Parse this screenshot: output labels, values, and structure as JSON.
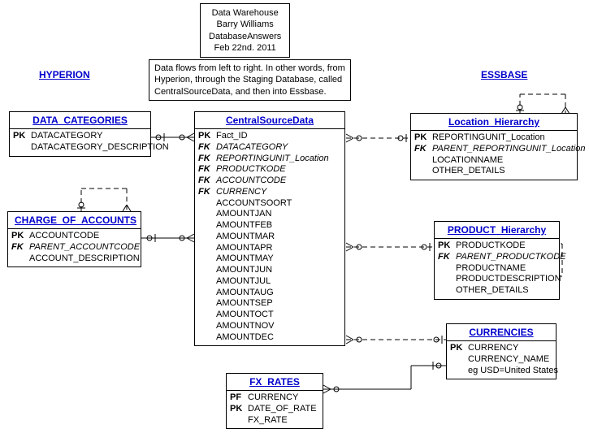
{
  "info": {
    "line1": "Data Warehouse",
    "line2": "Barry Williams",
    "line3": "DatabaseAnswers",
    "line4": "Feb 22nd. 2011"
  },
  "flow": {
    "line1": "Data flows from left to right. In other words, from",
    "line2": "Hyperion, through the Staging Database, called",
    "line3": "CentralSourceData, and then into Essbase."
  },
  "systems": {
    "left": "HYPERION",
    "right": "ESSBASE"
  },
  "entities": {
    "data_categories": {
      "title": "DATA_CATEGORIES",
      "rows": [
        {
          "k": "PK",
          "n": "DATACATEGORY"
        },
        {
          "k": "",
          "n": "DATACATEGORY_DESCRIPTION"
        }
      ]
    },
    "charge_of_accounts": {
      "title": "CHARGE_OF_ACCOUNTS",
      "rows": [
        {
          "k": "PK",
          "n": "ACCOUNTCODE"
        },
        {
          "k": "FK",
          "n": "PARENT_ACCOUNTCODE",
          "fk": true
        },
        {
          "k": "",
          "n": "ACCOUNT_DESCRIPTION"
        }
      ]
    },
    "central_source_data": {
      "title": "CentralSourceData",
      "rows": [
        {
          "k": "PK",
          "n": "Fact_ID"
        },
        {
          "k": "FK",
          "n": "DATACATEGORY",
          "fk": true
        },
        {
          "k": "FK",
          "n": "REPORTINGUNIT_Location",
          "fk": true
        },
        {
          "k": "FK",
          "n": "PRODUCTKODE",
          "fk": true
        },
        {
          "k": "FK",
          "n": "ACCOUNTCODE",
          "fk": true
        },
        {
          "k": "FK",
          "n": "CURRENCY",
          "fk": true
        },
        {
          "k": "",
          "n": "ACCOUNTSOORT"
        },
        {
          "k": "",
          "n": "AMOUNTJAN"
        },
        {
          "k": "",
          "n": "AMOUNTFEB"
        },
        {
          "k": "",
          "n": "AMOUNTMAR"
        },
        {
          "k": "",
          "n": "AMOUNTAPR"
        },
        {
          "k": "",
          "n": "AMOUNTMAY"
        },
        {
          "k": "",
          "n": "AMOUNTJUN"
        },
        {
          "k": "",
          "n": "AMOUNTJUL"
        },
        {
          "k": "",
          "n": "AMOUNTAUG"
        },
        {
          "k": "",
          "n": "AMOUNTSEP"
        },
        {
          "k": "",
          "n": "AMOUNTOCT"
        },
        {
          "k": "",
          "n": "AMOUNTNOV"
        },
        {
          "k": "",
          "n": "AMOUNTDEC"
        }
      ]
    },
    "location_hierarchy": {
      "title": "Location_Hierarchy",
      "rows": [
        {
          "k": "PK",
          "n": "REPORTINGUNIT_Location"
        },
        {
          "k": "FK",
          "n": "PARENT_REPORTINGUNIT_Location",
          "fk": true
        },
        {
          "k": "",
          "n": "LOCATIONNAME"
        },
        {
          "k": "",
          "n": "OTHER_DETAILS"
        }
      ]
    },
    "product_hierarchy": {
      "title": "PRODUCT_Hierarchy",
      "rows": [
        {
          "k": "PK",
          "n": "PRODUCTKODE"
        },
        {
          "k": "FK",
          "n": "PARENT_PRODUCTKODE",
          "fk": true
        },
        {
          "k": "",
          "n": "PRODUCTNAME"
        },
        {
          "k": "",
          "n": "PRODUCTDESCRIPTION"
        },
        {
          "k": "",
          "n": "OTHER_DETAILS"
        }
      ]
    },
    "currencies": {
      "title": "CURRENCIES",
      "rows": [
        {
          "k": "PK",
          "n": "CURRENCY"
        },
        {
          "k": "",
          "n": "CURRENCY_NAME"
        },
        {
          "k": "",
          "n": "eg USD=United States"
        }
      ]
    },
    "fx_rates": {
      "title": "FX_RATES",
      "rows": [
        {
          "k": "PF",
          "n": "CURRENCY"
        },
        {
          "k": "PK",
          "n": "DATE_OF_RATE"
        },
        {
          "k": "",
          "n": "FX_RATE"
        }
      ]
    }
  },
  "chart_data": {
    "type": "table",
    "diagram": "ER",
    "title": "Data Warehouse",
    "entities": [
      "DATA_CATEGORIES",
      "CHARGE_OF_ACCOUNTS",
      "CentralSourceData",
      "Location_Hierarchy",
      "PRODUCT_Hierarchy",
      "CURRENCIES",
      "FX_RATES"
    ],
    "relationships": [
      {
        "from": "DATA_CATEGORIES",
        "to": "CentralSourceData",
        "type": "one-to-many"
      },
      {
        "from": "CHARGE_OF_ACCOUNTS",
        "to": "CentralSourceData",
        "type": "one-to-many"
      },
      {
        "from": "CHARGE_OF_ACCOUNTS",
        "to": "CHARGE_OF_ACCOUNTS",
        "type": "self-one-to-many"
      },
      {
        "from": "CentralSourceData",
        "to": "Location_Hierarchy",
        "type": "many-to-one"
      },
      {
        "from": "Location_Hierarchy",
        "to": "Location_Hierarchy",
        "type": "self-one-to-many"
      },
      {
        "from": "CentralSourceData",
        "to": "PRODUCT_Hierarchy",
        "type": "many-to-one"
      },
      {
        "from": "PRODUCT_Hierarchy",
        "to": "PRODUCT_Hierarchy",
        "type": "self-one-to-many"
      },
      {
        "from": "CentralSourceData",
        "to": "CURRENCIES",
        "type": "many-to-one"
      },
      {
        "from": "CURRENCIES",
        "to": "FX_RATES",
        "type": "one-to-many"
      }
    ]
  }
}
